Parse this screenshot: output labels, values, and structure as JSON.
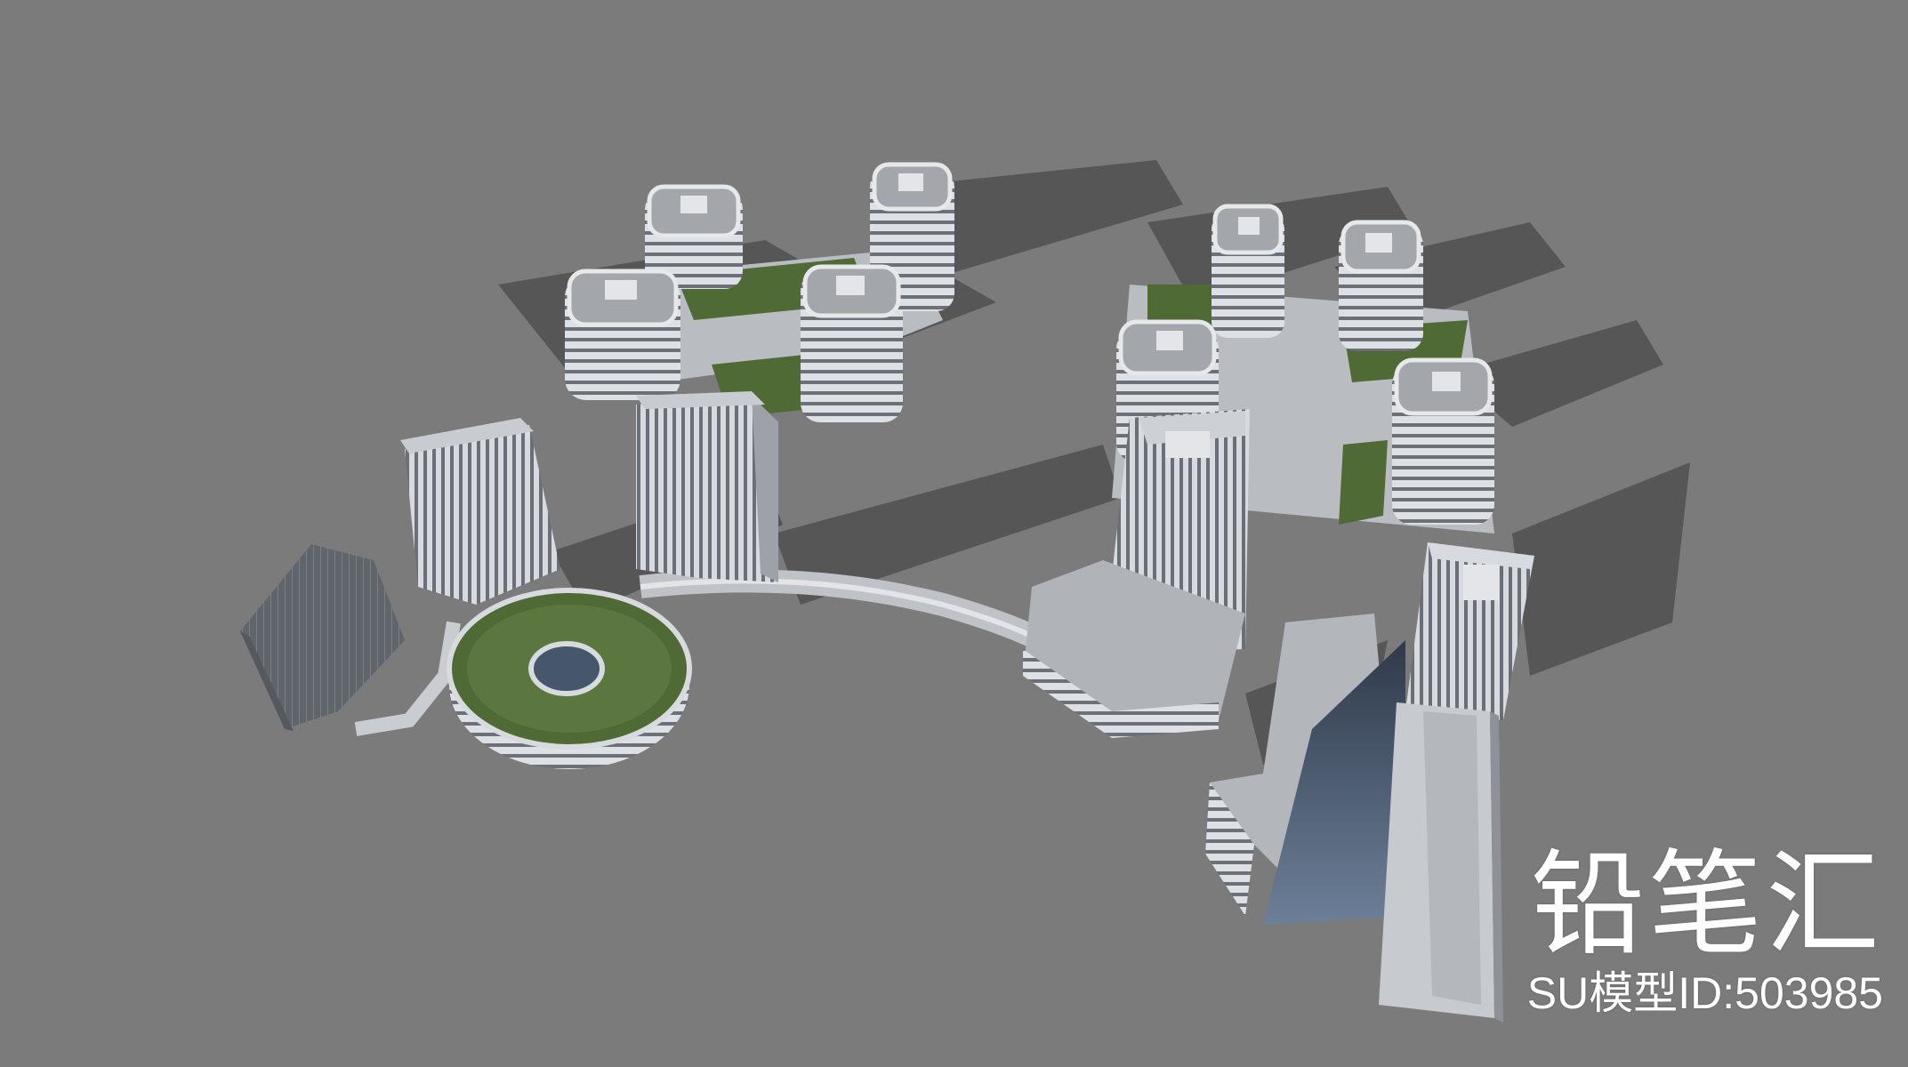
{
  "scene": {
    "subject": "3D model render of a mixed-use campus",
    "background_color": "#7b7b7b",
    "roof_green": "#4f6a35",
    "facade_light": "#d6d9de",
    "facade_dark": "#5d6169",
    "shadow_color": "#545454",
    "glass_color": "#3e4f66"
  },
  "watermark": {
    "brand": "铅笔汇",
    "model_id": "SU模型ID:503985"
  }
}
